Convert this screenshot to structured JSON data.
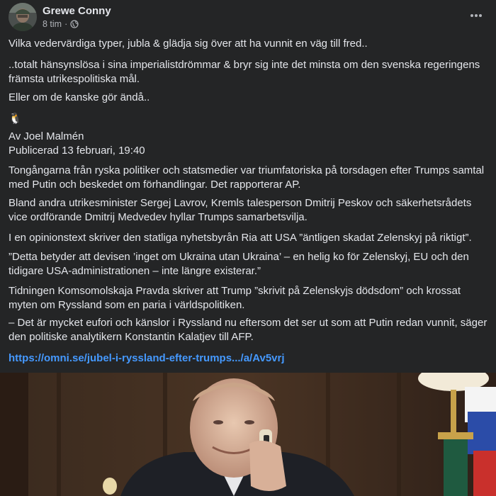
{
  "post": {
    "author": "Grewe Conny",
    "time": "8 tim",
    "separator": "·",
    "lines": [
      "Vilka vedervärdiga typer, jubla & glädja sig över att ha vunnit en väg till fred..",
      "..totalt hänsynslösa i sina imperialistdrömmar & bryr sig inte det minsta om den svenska regeringens främsta utrikespolitiska mål.",
      "Eller om de kanske gör ändå..",
      "🐧",
      "Av Joel Malmén",
      "Publicerad 13 februari, 19:40",
      "Tongångarna från ryska politiker och statsmedier var triumfatoriska på torsdagen efter Trumps samtal med Putin och beskedet om förhandlingar. Det rapporterar AP.",
      "Bland andra utrikesminister Sergej Lavrov, Kremls talesperson Dmitrij Peskov och säkerhetsrådets vice ordförande Dmitrij Medvedev hyllar Trumps samarbetsvilja.",
      "I en opinionstext skriver den statliga nyhetsbyrån Ria att USA ”äntligen skadat Zelenskyj på riktigt”.",
      "”Detta betyder att devisen ’inget om Ukraina utan Ukraina’ – en helig ko för Zelenskyj, EU och den tidigare USA-administrationen – inte längre existerar.”",
      "Tidningen Komsomolskaja Pravda skriver att Trump ”skrivit på Zelenskyjs dödsdom” och krossat myten om Ryssland som en paria i världspolitiken.",
      "– Det är mycket eufori och känslor i Ryssland nu eftersom det ser ut som att Putin redan vunnit, säger den politiske analytikern Konstantin Kalatjev till AFP."
    ],
    "link": "https://omni.se/jubel-i-ryssland-efter-trumps.../a/Av5vrj"
  },
  "colors": {
    "background": "#242526",
    "text": "#e4e6eb",
    "secondary_text": "#b0b3b8",
    "link": "#4599ff"
  },
  "icons": {
    "privacy": "globe-icon",
    "menu": "more-horizontal-icon"
  }
}
